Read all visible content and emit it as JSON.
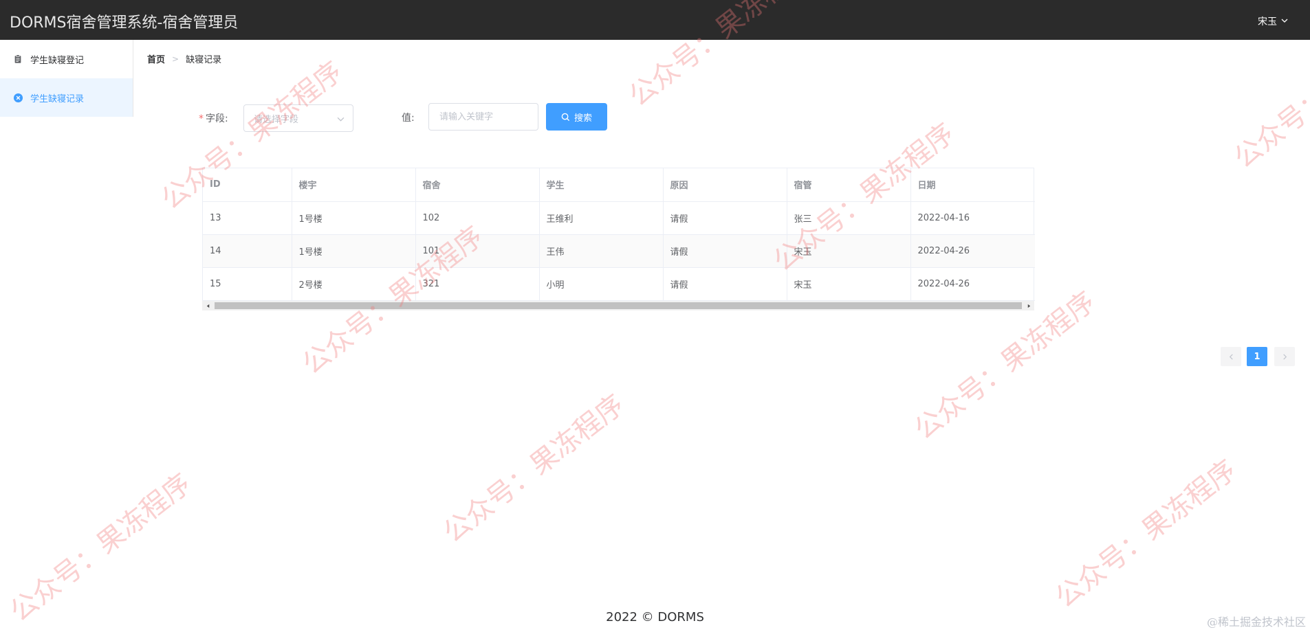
{
  "header": {
    "app_title": "DORMS宿舍管理系统-宿舍管理员",
    "user_name": "宋玉"
  },
  "sidebar": {
    "items": [
      {
        "label": "学生缺寝登记",
        "icon": "clipboard-icon",
        "active": false
      },
      {
        "label": "学生缺寝记录",
        "icon": "close-circle-icon",
        "active": true
      }
    ]
  },
  "breadcrumb": {
    "home": "首页",
    "current": "缺寝记录"
  },
  "search_form": {
    "field_label": "字段:",
    "field_placeholder": "请选择字段",
    "value_label": "值:",
    "value_placeholder": "请输入关键字",
    "search_button": "搜索"
  },
  "table": {
    "columns": [
      "ID",
      "楼宇",
      "宿舍",
      "学生",
      "原因",
      "宿管",
      "日期"
    ],
    "rows": [
      [
        "13",
        "1号楼",
        "102",
        "王维利",
        "请假",
        "张三",
        "2022-04-16"
      ],
      [
        "14",
        "1号楼",
        "101",
        "王伟",
        "请假",
        "宋玉",
        "2022-04-26"
      ],
      [
        "15",
        "2号楼",
        "321",
        "小明",
        "请假",
        "宋玉",
        "2022-04-26"
      ]
    ]
  },
  "pagination": {
    "current_page": "1"
  },
  "footer": {
    "copyright": "2022 © DORMS",
    "credit": "@稀土掘金技术社区"
  },
  "watermark": {
    "text": "公众号：果冻程序"
  },
  "colors": {
    "topbar": "#2b2b2b",
    "accent": "#409eff",
    "active_bg": "#ecf5ff"
  }
}
